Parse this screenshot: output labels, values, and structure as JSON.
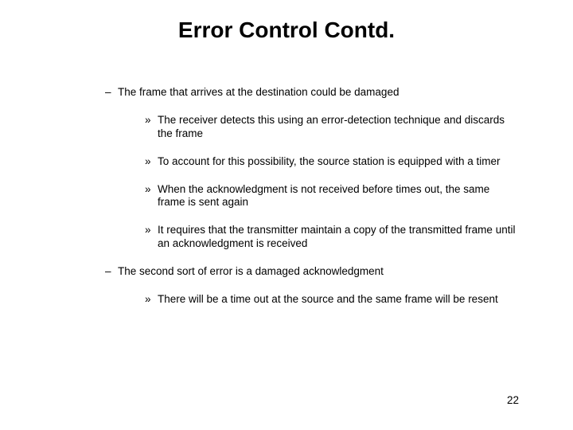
{
  "title": "Error Control Contd.",
  "bullets": {
    "a": "The frame that arrives at the destination could be damaged",
    "a1": "The receiver detects this using an error-detection technique and discards the frame",
    "a2": "To account for this possibility, the source station is equipped with a timer",
    "a3": "When the acknowledgment is not received before times out, the same frame is sent again",
    "a4": "It requires that the transmitter maintain a copy of the transmitted frame until an acknowledgment is received",
    "b": "The second sort of error is a damaged acknowledgment",
    "b1": "There will be a time out at the source and the same frame will be resent"
  },
  "page_number": "22"
}
